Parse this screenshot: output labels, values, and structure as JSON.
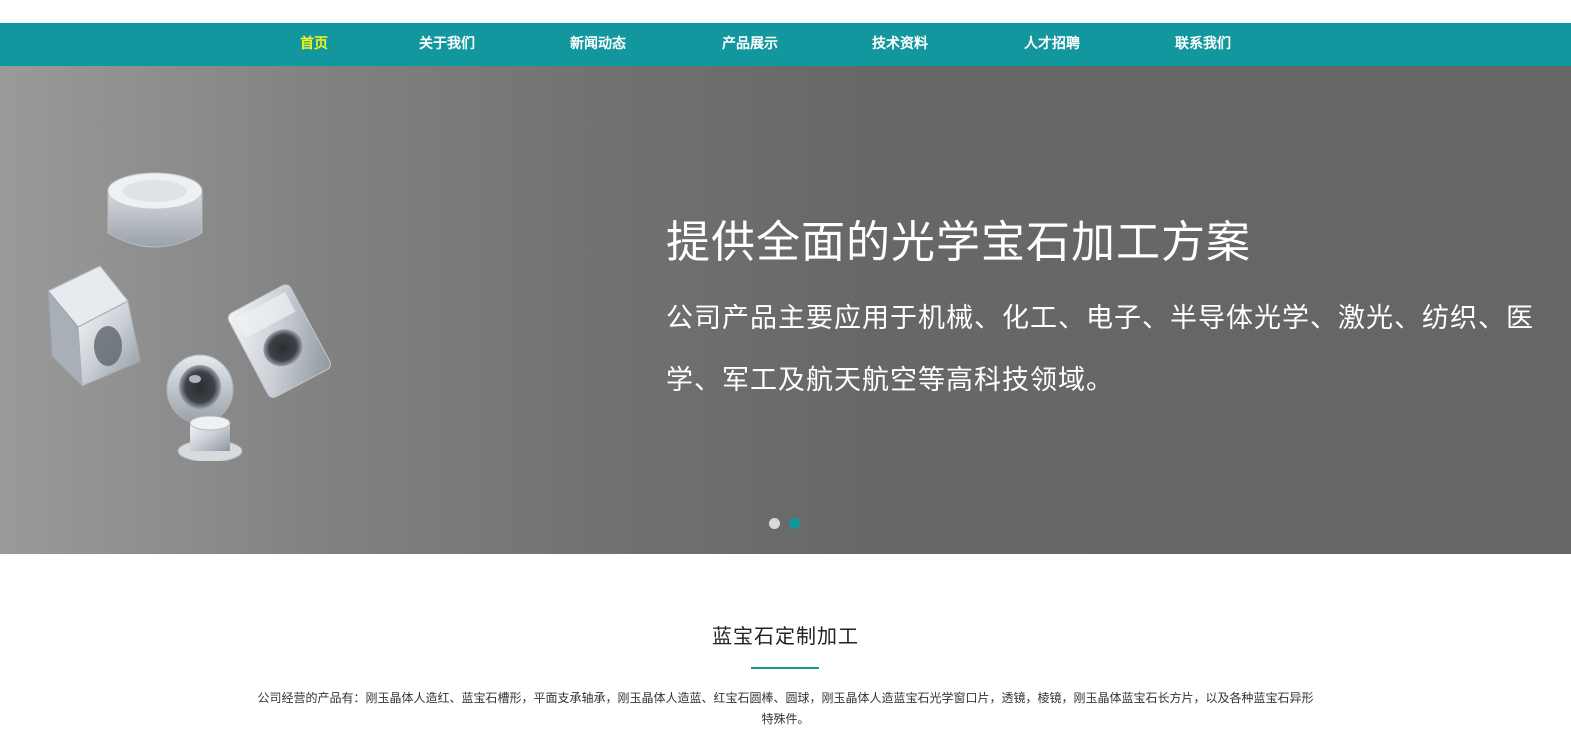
{
  "nav": {
    "items": [
      {
        "label": "首页",
        "active": true
      },
      {
        "label": "关于我们",
        "active": false
      },
      {
        "label": "新闻动态",
        "active": false
      },
      {
        "label": "产品展示",
        "active": false
      },
      {
        "label": "技术资料",
        "active": false
      },
      {
        "label": "人才招聘",
        "active": false
      },
      {
        "label": "联系我们",
        "active": false
      }
    ],
    "background": "#13979f",
    "active_color": "#f5f31c"
  },
  "banner": {
    "title": "提供全面的光学宝石加工方案",
    "description": "公司产品主要应用于机械、化工、电子、半导体光学、激光、纺织、医学、军工及航天航空等高科技领域。",
    "slide_count": 2,
    "active_slide": 2
  },
  "section": {
    "title": "蓝宝石定制加工",
    "text": "公司经营的产品有：刚玉晶体人造红、蓝宝石槽形，平面支承轴承，刚玉晶体人造蓝、红宝石圆棒、圆球，刚玉晶体人造蓝宝石光学窗口片，透镜，棱镜，刚玉晶体蓝宝石长方片，以及各种蓝宝石异形特殊件。",
    "accent": "#13979f"
  }
}
